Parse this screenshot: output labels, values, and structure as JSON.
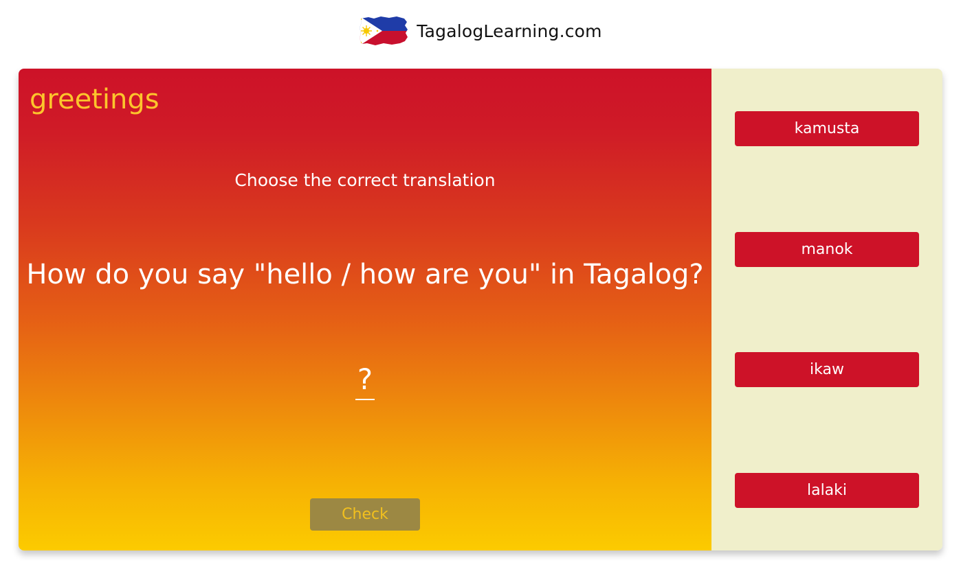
{
  "header": {
    "site_name": "TagalogLearning.com",
    "logo_icon": "philippines-flag-icon"
  },
  "lesson": {
    "category": "greetings",
    "instruction": "Choose the correct translation",
    "question": "How do you say \"hello / how are you\" in Tagalog?",
    "answer_placeholder": "?",
    "check_label": "Check"
  },
  "options": [
    {
      "label": "kamusta"
    },
    {
      "label": "manok"
    },
    {
      "label": "ikaw"
    },
    {
      "label": "lalaki"
    }
  ],
  "colors": {
    "primary_red": "#cd1228",
    "gradient_end_yellow": "#fccb00",
    "category_text": "#fcc52c",
    "options_panel_bg": "#f0efcb",
    "check_button_bg": "#9c8843",
    "check_button_text": "#f2c01e"
  }
}
